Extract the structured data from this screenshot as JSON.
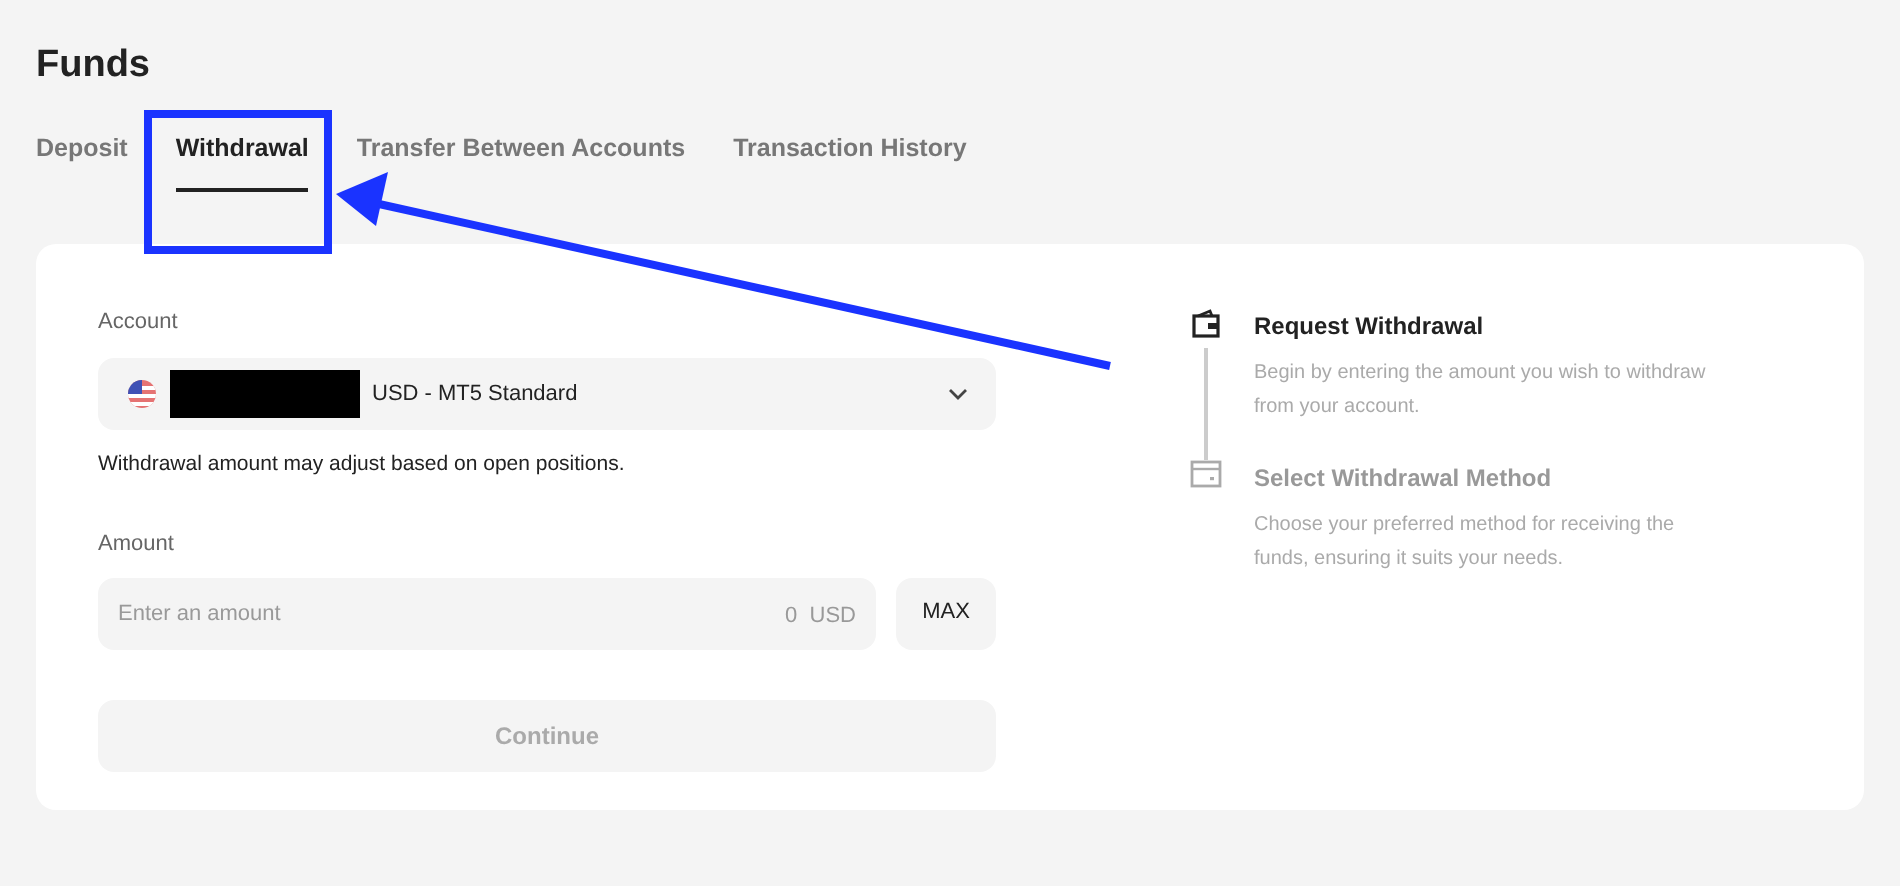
{
  "page": {
    "title": "Funds"
  },
  "tabs": [
    {
      "label": "Deposit",
      "selected": false
    },
    {
      "label": "Withdrawal",
      "selected": true
    },
    {
      "label": "Transfer Between Accounts",
      "selected": false
    },
    {
      "label": "Transaction History",
      "selected": false
    }
  ],
  "form": {
    "account_label": "Account",
    "account_value": "USD - MT5 Standard",
    "account_redacted": true,
    "note": "Withdrawal amount may adjust based on open positions.",
    "amount_label": "Amount",
    "amount_placeholder": "Enter an amount",
    "amount_suffix": "0  USD",
    "max_button": "MAX",
    "continue_button": "Continue",
    "continue_disabled": true
  },
  "steps": [
    {
      "kind": "wallet",
      "title": "Request Withdrawal",
      "description": "Begin by entering the amount you wish to withdraw from your account.",
      "active": true
    },
    {
      "kind": "card",
      "title": "Select Withdrawal Method",
      "description": "Choose your preferred method for receiving the funds, ensuring it suits your needs.",
      "active": false
    }
  ],
  "annotation": {
    "shown": true
  }
}
